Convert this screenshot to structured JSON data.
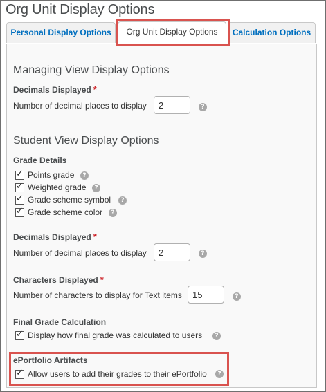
{
  "page_title": "Org Unit Display Options",
  "tabs": [
    {
      "label": "Personal Display Options"
    },
    {
      "label": "Org Unit Display Options"
    },
    {
      "label": "Calculation Options"
    }
  ],
  "managing": {
    "title": "Managing View Display Options",
    "decimals_label": "Decimals Displayed",
    "decimals_text": "Number of decimal places to display",
    "decimals_value": "2"
  },
  "student": {
    "title": "Student View Display Options",
    "grade_details_label": "Grade Details",
    "grade_details": [
      {
        "label": "Points grade"
      },
      {
        "label": "Weighted grade"
      },
      {
        "label": "Grade scheme symbol"
      },
      {
        "label": "Grade scheme color"
      }
    ],
    "decimals_label": "Decimals Displayed",
    "decimals_text": "Number of decimal places to display",
    "decimals_value": "2",
    "characters_label": "Characters Displayed",
    "characters_text": "Number of characters to display for Text items",
    "characters_value": "15",
    "final_label": "Final Grade Calculation",
    "final_text": "Display how final grade was calculated to users",
    "eport_label": "ePortfolio Artifacts",
    "eport_text": "Allow users to add their grades to their ePortfolio"
  },
  "required_mark": "*",
  "help_glyph": "?",
  "colors": {
    "link": "#006fbf",
    "highlight": "#d9534f",
    "required": "#cd2026"
  }
}
